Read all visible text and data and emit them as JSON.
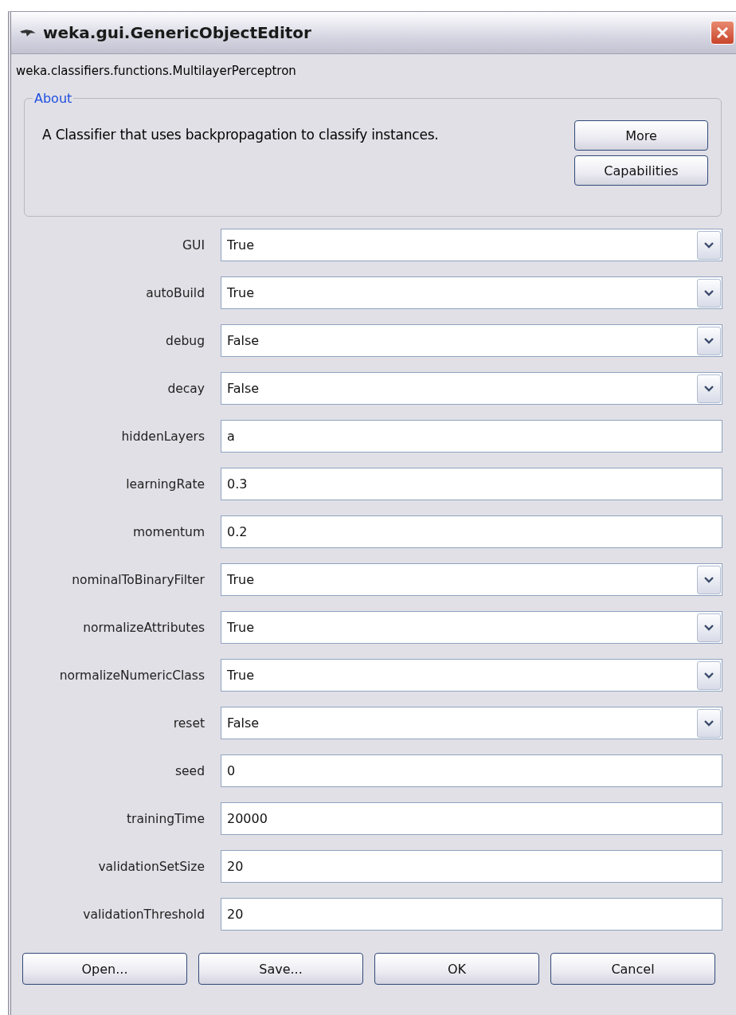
{
  "window": {
    "title": "weka.gui.GenericObjectEditor"
  },
  "class_name": "weka.classifiers.functions.MultilayerPerceptron",
  "about": {
    "legend": "About",
    "description": "A Classifier that uses backpropagation to classify instances.",
    "buttons": [
      "More",
      "Capabilities"
    ]
  },
  "properties": [
    {
      "label": "GUI",
      "kind": "choice",
      "value": "True"
    },
    {
      "label": "autoBuild",
      "kind": "choice",
      "value": "True"
    },
    {
      "label": "debug",
      "kind": "choice",
      "value": "False"
    },
    {
      "label": "decay",
      "kind": "choice",
      "value": "False"
    },
    {
      "label": "hiddenLayers",
      "kind": "text",
      "value": "a"
    },
    {
      "label": "learningRate",
      "kind": "text",
      "value": "0.3"
    },
    {
      "label": "momentum",
      "kind": "text",
      "value": "0.2"
    },
    {
      "label": "nominalToBinaryFilter",
      "kind": "choice",
      "value": "True"
    },
    {
      "label": "normalizeAttributes",
      "kind": "choice",
      "value": "True"
    },
    {
      "label": "normalizeNumericClass",
      "kind": "choice",
      "value": "True"
    },
    {
      "label": "reset",
      "kind": "choice",
      "value": "False"
    },
    {
      "label": "seed",
      "kind": "text",
      "value": "0"
    },
    {
      "label": "trainingTime",
      "kind": "text",
      "value": "20000"
    },
    {
      "label": "validationSetSize",
      "kind": "text",
      "value": "20"
    },
    {
      "label": "validationThreshold",
      "kind": "text",
      "value": "20"
    }
  ],
  "buttons": [
    "Open...",
    "Save...",
    "OK",
    "Cancel"
  ]
}
